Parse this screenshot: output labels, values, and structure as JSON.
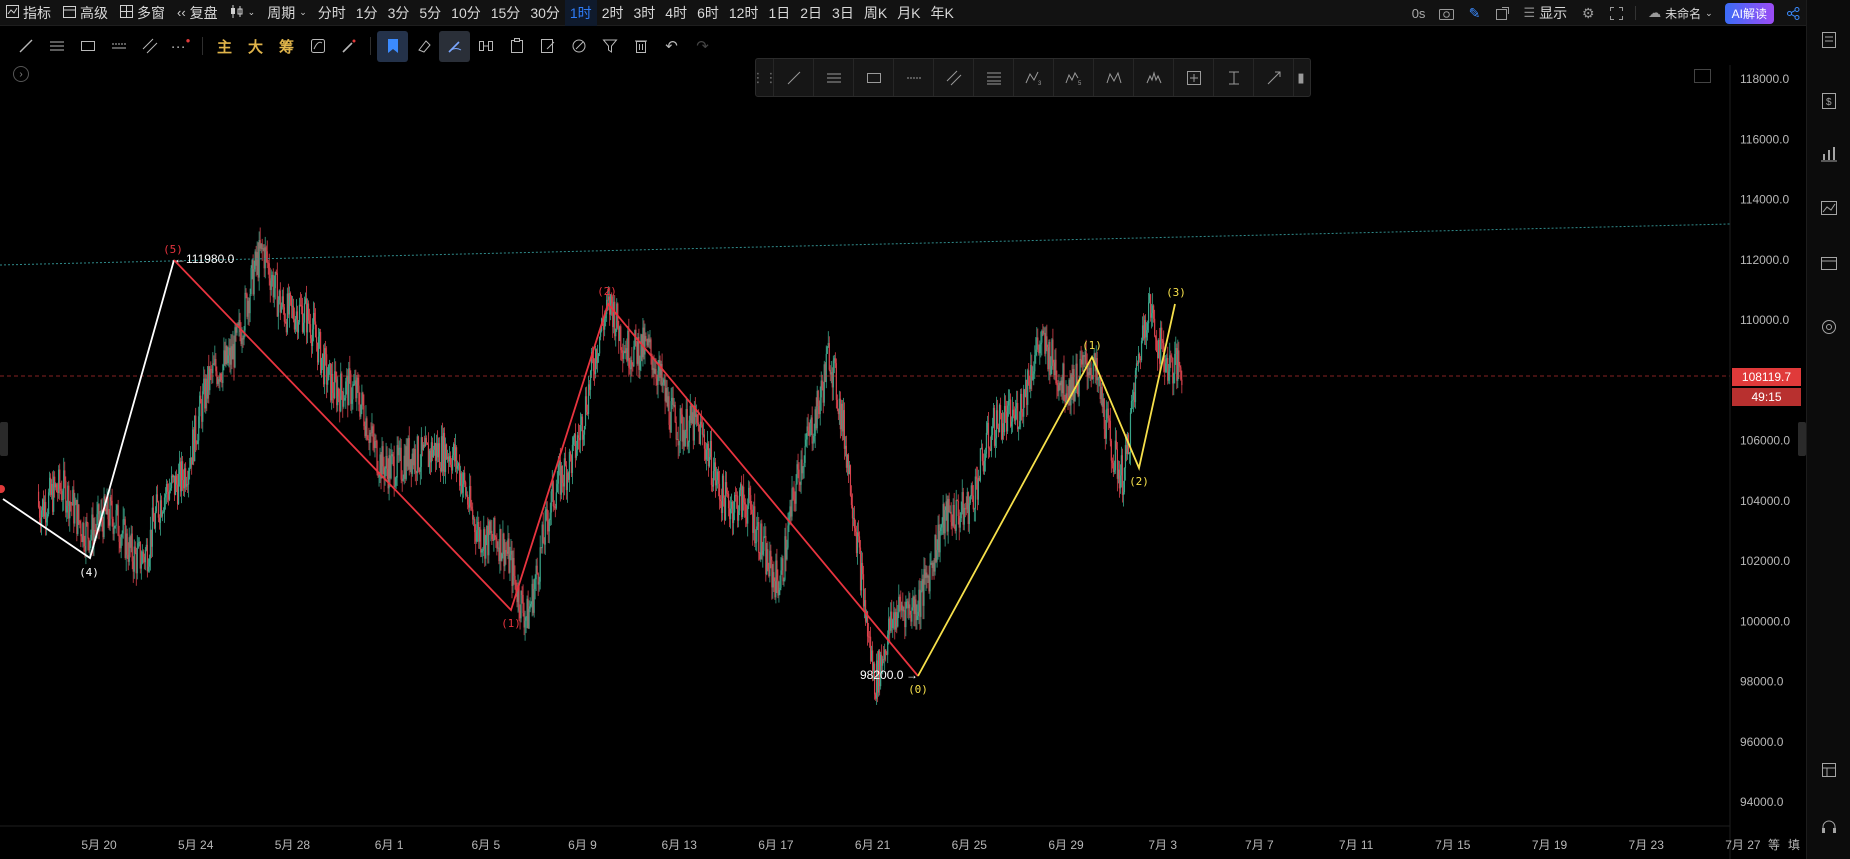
{
  "topbar": {
    "items": [
      {
        "name": "indicator",
        "icon": "chart-line-icon",
        "label": "指标"
      },
      {
        "name": "advanced",
        "icon": "calendar-icon",
        "label": "高级"
      },
      {
        "name": "multi-window",
        "icon": "grid-icon",
        "label": "多窗"
      },
      {
        "name": "replay",
        "icon": "rewind-icon",
        "label": "复盘"
      },
      {
        "name": "chart-type",
        "icon": "candles-icon",
        "label": ""
      },
      {
        "name": "period",
        "icon": "chevron-down-icon",
        "label": "周期"
      }
    ],
    "intervals": [
      "分时",
      "1分",
      "3分",
      "5分",
      "10分",
      "15分",
      "30分",
      "1时",
      "2时",
      "3时",
      "4时",
      "6时",
      "12时",
      "1日",
      "2日",
      "3日",
      "周K",
      "月K",
      "年K"
    ],
    "active_interval": "1时",
    "right": {
      "countdown": "0s",
      "display_label": "显示",
      "layout_name": "未命名",
      "ai_label": "AI解读"
    }
  },
  "drawbar": {
    "cn_tools": [
      "主",
      "大",
      "筹"
    ]
  },
  "chart": {
    "price_ticks": [
      "118000.0",
      "116000.0",
      "114000.0",
      "112000.0",
      "110000.0",
      "108000.0",
      "106000.0",
      "104000.0",
      "102000.0",
      "100000.0",
      "98000.0",
      "96000.0",
      "94000.0"
    ],
    "date_ticks": [
      "5月 20",
      "5月 24",
      "5月 28",
      "6月 1",
      "6月 5",
      "6月 9",
      "6月 13",
      "6月 17",
      "6月 21",
      "6月 25",
      "6月 29",
      "7月 3",
      "7月 7",
      "7月 11",
      "7月 15",
      "7月 19",
      "7月 23",
      "7月 27"
    ],
    "axis_corner_labels": [
      "等",
      "填"
    ],
    "current_price": "108119.7",
    "countdown": "49:15",
    "high_label": "111980.0",
    "low_label": "98200.0",
    "colors": {
      "white_wave": "#ffffff",
      "red_wave": "#e8343f",
      "yellow_wave": "#f6e04b",
      "up": "#3aa58a",
      "down": "#d8424c",
      "trendline": "#2f8a8a",
      "current": "#e03a3a"
    },
    "waves": {
      "white": [
        {
          "label": "(4)"
        },
        {
          "label": "(5)"
        }
      ],
      "red": [
        {
          "label": "(1)"
        },
        {
          "label": "(2)"
        }
      ],
      "yellow": [
        {
          "label": "(0)"
        },
        {
          "label": "(1)"
        },
        {
          "label": "(2)"
        },
        {
          "label": "(3)"
        }
      ]
    }
  }
}
